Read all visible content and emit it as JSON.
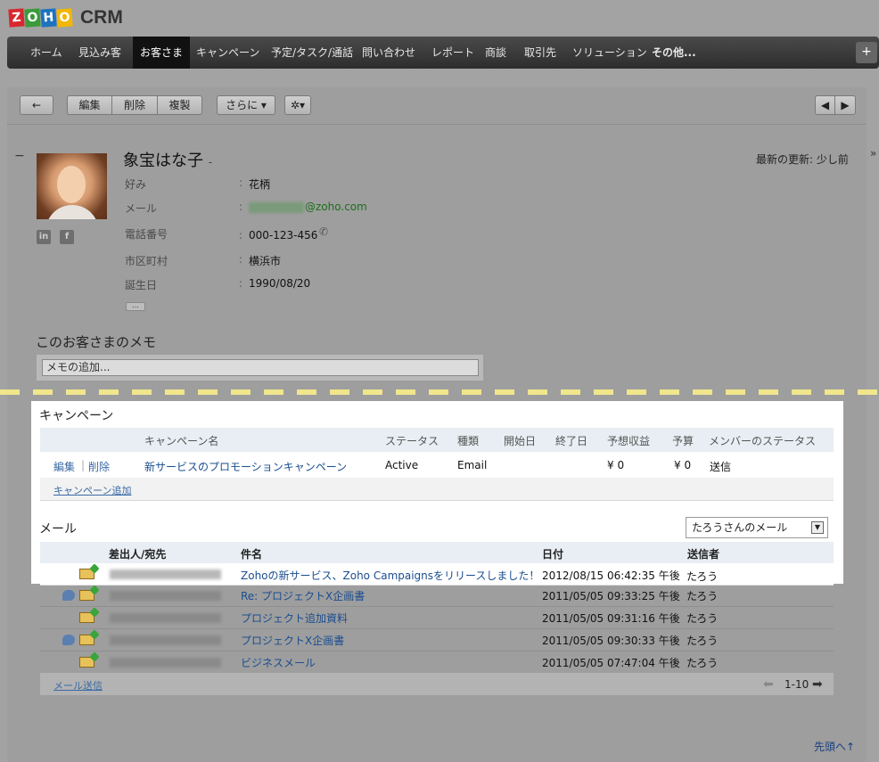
{
  "app": {
    "logo_letters": [
      "Z",
      "O",
      "H",
      "O"
    ],
    "logo_colors": [
      "#d7282f",
      "#3a9b3a",
      "#1e73be",
      "#f2b705"
    ],
    "product": "CRM"
  },
  "nav": {
    "items": [
      "ホーム",
      "見込み客",
      "お客さま",
      "キャンペーン",
      "予定/タスク/通話",
      "問い合わせ",
      "レポート",
      "商談",
      "取引先",
      "ソリューション"
    ],
    "active": "お客さま",
    "more": "その他...",
    "plus": "+"
  },
  "toolbar": {
    "back": "←",
    "edit": "編集",
    "delete": "削除",
    "clone": "複製",
    "more": "さらに ▾",
    "gear": "✲▾",
    "prev": "◀",
    "next": "▶"
  },
  "record": {
    "collapse": "−",
    "side_toggle": "»",
    "name": "象宝はな子",
    "name_suffix": "-",
    "last_updated": "最新の更新: 少し前",
    "social": [
      "in",
      "f"
    ],
    "fields": [
      {
        "label": "好み",
        "value": "花柄"
      },
      {
        "label": "メール",
        "value": "@zoho.com"
      },
      {
        "label": "電話番号",
        "value": "000-123-456"
      },
      {
        "label": "市区町村",
        "value": "横浜市"
      },
      {
        "label": "誕生日",
        "value": "1990/08/20"
      }
    ],
    "more_fields": "…"
  },
  "memo": {
    "title": "このお客さまのメモ",
    "placeholder": "メモの追加..."
  },
  "campaigns": {
    "title": "キャンペーン",
    "headers": [
      "キャンペーン名",
      "ステータス",
      "種類",
      "開始日",
      "終了日",
      "予想収益",
      "予算",
      "メンバーのステータス"
    ],
    "rows": [
      {
        "edit": "編集",
        "sep": "|",
        "delete": "削除",
        "name": "新サービスのプロモーションキャンペーン",
        "status": "Active",
        "type": "Email",
        "start": "",
        "end": "",
        "expected_revenue": "¥ 0",
        "budget": "¥ 0",
        "member_status": "送信"
      }
    ],
    "add_link": "キャンペーン追加"
  },
  "mail": {
    "title": "メール",
    "filter": "たろうさんのメール",
    "headers": [
      "差出人/宛先",
      "件名",
      "日付",
      "送信者"
    ],
    "rows": [
      {
        "subject": "Zohoの新サービス、Zoho Campaignsをリリースしました！",
        "date": "2012/08/15 06:42:35 午後",
        "sender": "たろう",
        "thread": false
      },
      {
        "subject": "Re: プロジェクトX企画書",
        "date": "2011/05/05 09:33:25 午後",
        "sender": "たろう",
        "thread": true
      },
      {
        "subject": "プロジェクト追加資料",
        "date": "2011/05/05 09:31:16 午後",
        "sender": "たろう",
        "thread": false
      },
      {
        "subject": "プロジェクトX企画書",
        "date": "2011/05/05 09:30:33 午後",
        "sender": "たろう",
        "thread": true
      },
      {
        "subject": "ビジネスメール",
        "date": "2011/05/05 07:47:04 午後",
        "sender": "たろう",
        "thread": false
      }
    ],
    "send_link": "メール送信",
    "pagination": "1-10"
  },
  "footer": {
    "top_link": "先頭へ↑"
  }
}
